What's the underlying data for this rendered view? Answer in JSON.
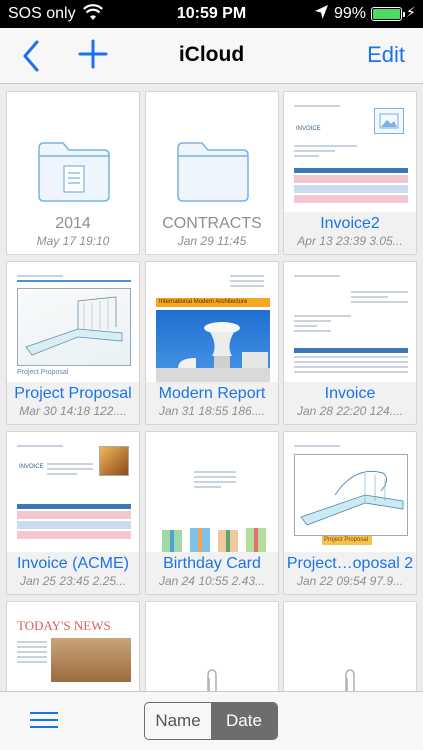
{
  "status_bar": {
    "carrier": "SOS only",
    "time": "10:59 PM",
    "battery_percent": "99%",
    "battery_level": 0.99
  },
  "nav": {
    "title": "iCloud",
    "edit_label": "Edit",
    "accent_color": "#1a73e8"
  },
  "items": [
    {
      "name": "2014",
      "date": "May 17 19:10",
      "kind": "folder"
    },
    {
      "name": "CONTRACTS",
      "date": "Jan 29 11:45",
      "kind": "folder"
    },
    {
      "name": "Invoice2",
      "date": "Apr 13 23:39 3.05...",
      "kind": "document"
    },
    {
      "name": "Project Proposal",
      "date": "Mar 30 14:18 122....",
      "kind": "document"
    },
    {
      "name": "Modern Report",
      "date": "Jan 31 18:55 186....",
      "kind": "document"
    },
    {
      "name": "Invoice",
      "date": "Jan 28 22:20 124....",
      "kind": "document"
    },
    {
      "name": "Invoice (ACME)",
      "date": "Jan 25 23:45 2.25...",
      "kind": "document"
    },
    {
      "name": "Birthday Card",
      "date": "Jan 24 10:55 2.43...",
      "kind": "document"
    },
    {
      "name": "Project…oposal 2",
      "date": "Jan 22 09:54 97.9...",
      "kind": "document"
    }
  ],
  "thumbnails": {
    "invoice_heading": "INVOICE",
    "report_banner": "International Modern Architecture",
    "proposal_heading": "Project Proposal",
    "news_heading": "TODAY'S NEWS"
  },
  "sort": {
    "name_label": "Name",
    "date_label": "Date",
    "selected": "Date"
  }
}
